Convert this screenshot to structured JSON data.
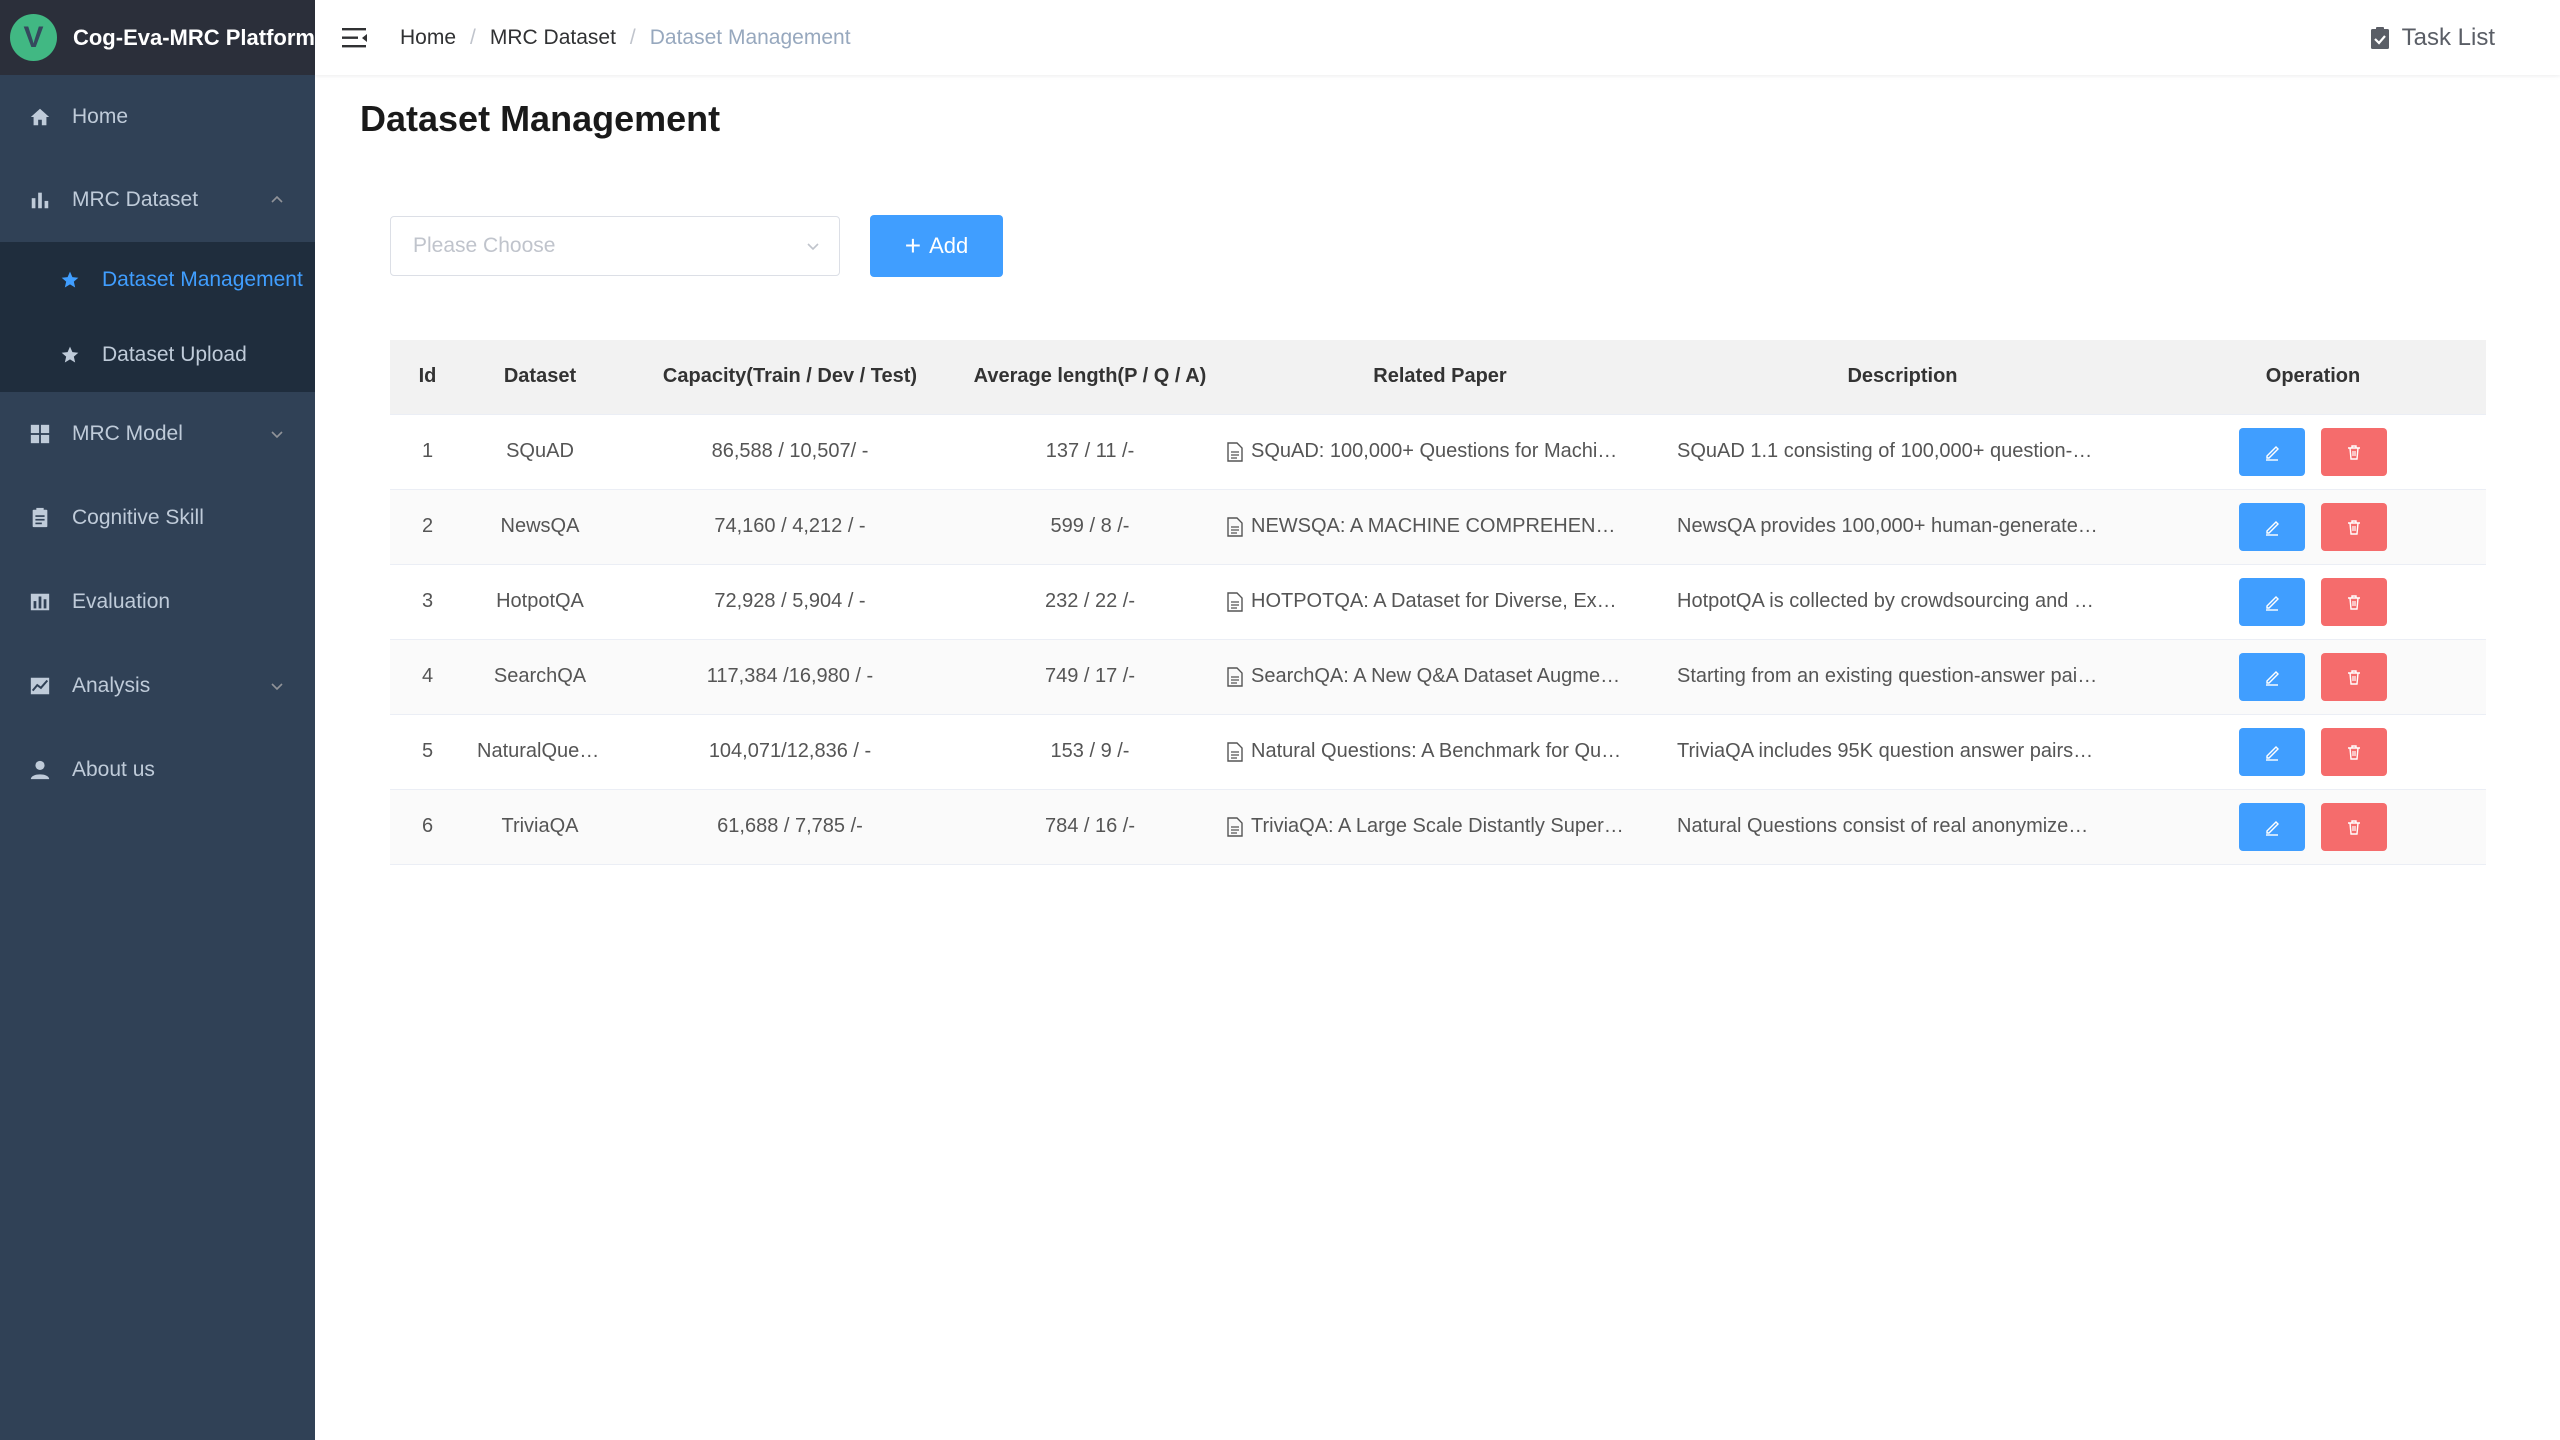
{
  "app": {
    "title": "Cog-Eva-MRC Platform",
    "logo_letter": "V"
  },
  "sidebar": {
    "items": [
      {
        "label": "Home",
        "icon": "home-icon"
      },
      {
        "label": "MRC Dataset",
        "icon": "bar-chart-icon",
        "expanded": true,
        "children": [
          {
            "label": "Dataset Management",
            "icon": "star-icon",
            "active": true
          },
          {
            "label": "Dataset Upload",
            "icon": "star-icon"
          }
        ]
      },
      {
        "label": "MRC Model",
        "icon": "grid-icon"
      },
      {
        "label": "Cognitive Skill",
        "icon": "clipboard-icon"
      },
      {
        "label": "Evaluation",
        "icon": "chart-icon"
      },
      {
        "label": "Analysis",
        "icon": "trend-chart-icon"
      },
      {
        "label": "About us",
        "icon": "user-icon"
      }
    ]
  },
  "header": {
    "breadcrumb": [
      "Home",
      "MRC Dataset",
      "Dataset Management"
    ],
    "task_list": "Task List"
  },
  "page": {
    "title": "Dataset Management",
    "filter_placeholder": "Please Choose",
    "add_label": "Add"
  },
  "table": {
    "columns": [
      "Id",
      "Dataset",
      "Capacity(Train / Dev / Test)",
      "Average length(P / Q / A)",
      "Related Paper",
      "Description",
      "Operation"
    ],
    "rows": [
      {
        "id": "1",
        "dataset": "SQuAD",
        "capacity": "86,588 / 10,507/ -",
        "avg_length": "137 / 11 /-",
        "paper": "SQuAD: 100,000+ Questions for Machi…",
        "description": "SQuAD 1.1 consisting of 100,000+ question-…"
      },
      {
        "id": "2",
        "dataset": "NewsQA",
        "capacity": "74,160 / 4,212 / -",
        "avg_length": "599 / 8 /-",
        "paper": "NEWSQA: A MACHINE COMPREHEN…",
        "description": "NewsQA provides 100,000+ human-generate…"
      },
      {
        "id": "3",
        "dataset": "HotpotQA",
        "capacity": "72,928 / 5,904 / -",
        "avg_length": "232 / 22 /-",
        "paper": "HOTPOTQA: A Dataset for Diverse, Ex…",
        "description": "HotpotQA is collected by crowdsourcing and …"
      },
      {
        "id": "4",
        "dataset": "SearchQA",
        "capacity": "117,384 /16,980 / -",
        "avg_length": "749 / 17 /-",
        "paper": "SearchQA: A New Q&A Dataset Augme…",
        "description": "Starting from an existing question-answer pai…"
      },
      {
        "id": "5",
        "dataset": "NaturalQuestions",
        "capacity": "104,071/12,836 / -",
        "avg_length": "153 / 9 /-",
        "paper": "Natural Questions: A Benchmark for Qu…",
        "description": "TriviaQA includes 95K question answer pairs…"
      },
      {
        "id": "6",
        "dataset": "TriviaQA",
        "capacity": "61,688 / 7,785 /-",
        "avg_length": "784 / 16 /-",
        "paper": "TriviaQA: A Large Scale Distantly Super…",
        "description": "Natural Questions consist of real anonymize…"
      }
    ]
  },
  "colors": {
    "sidebar_bg": "#304156",
    "submenu_bg": "#1f2d3d",
    "accent": "#409eff",
    "danger": "#f56c6c"
  }
}
